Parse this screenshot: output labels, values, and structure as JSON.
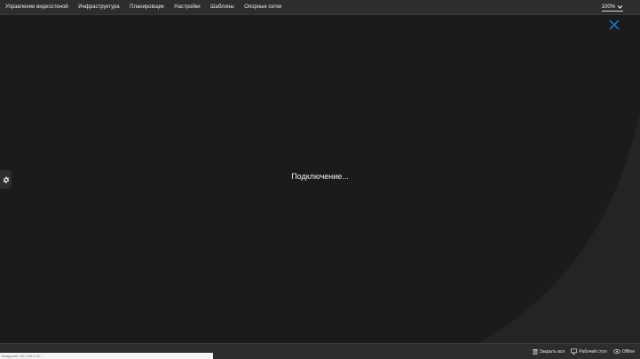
{
  "menu": {
    "items": [
      {
        "label": "Управление видеостеной"
      },
      {
        "label": "Инфраструктура"
      },
      {
        "label": "Планировщик"
      },
      {
        "label": "Настройки"
      },
      {
        "label": "Шаблоны"
      },
      {
        "label": "Опорные сетки"
      }
    ],
    "zoom_value": "100%"
  },
  "content": {
    "status_text": "Подключение...",
    "close_icon": "close-icon",
    "settings_icon": "gear-icon"
  },
  "bottom": {
    "status_placeholder": "Ожидание 192.168.0.10...",
    "actions": [
      {
        "label": "Закрыть все",
        "icon": "trash-icon"
      },
      {
        "label": "Рабочий стол",
        "icon": "monitor-icon"
      },
      {
        "label": "Offline",
        "icon": "eye-off-icon"
      }
    ]
  },
  "colors": {
    "background": "#1b1b1b",
    "bar": "#2d2d2d",
    "accent": "#1e7fd6",
    "curve": "#242424"
  }
}
